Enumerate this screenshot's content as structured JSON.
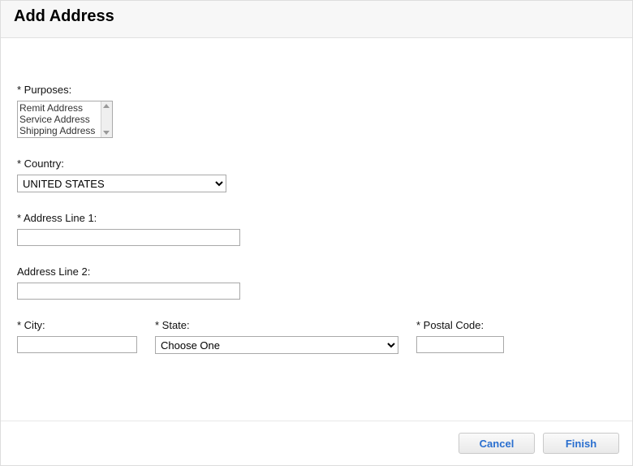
{
  "dialog": {
    "title": "Add Address"
  },
  "form": {
    "purposes": {
      "label": "* Purposes:",
      "options": [
        "Remit Address",
        "Service Address",
        "Shipping Address"
      ]
    },
    "country": {
      "label": "* Country:",
      "value": "UNITED STATES"
    },
    "address1": {
      "label": "* Address Line 1:"
    },
    "address2": {
      "label": "Address Line 2:"
    },
    "city": {
      "label": "* City:"
    },
    "state": {
      "label": "* State:",
      "value": "Choose One"
    },
    "postal": {
      "label": "* Postal Code:"
    }
  },
  "footer": {
    "cancel": "Cancel",
    "finish": "Finish"
  }
}
